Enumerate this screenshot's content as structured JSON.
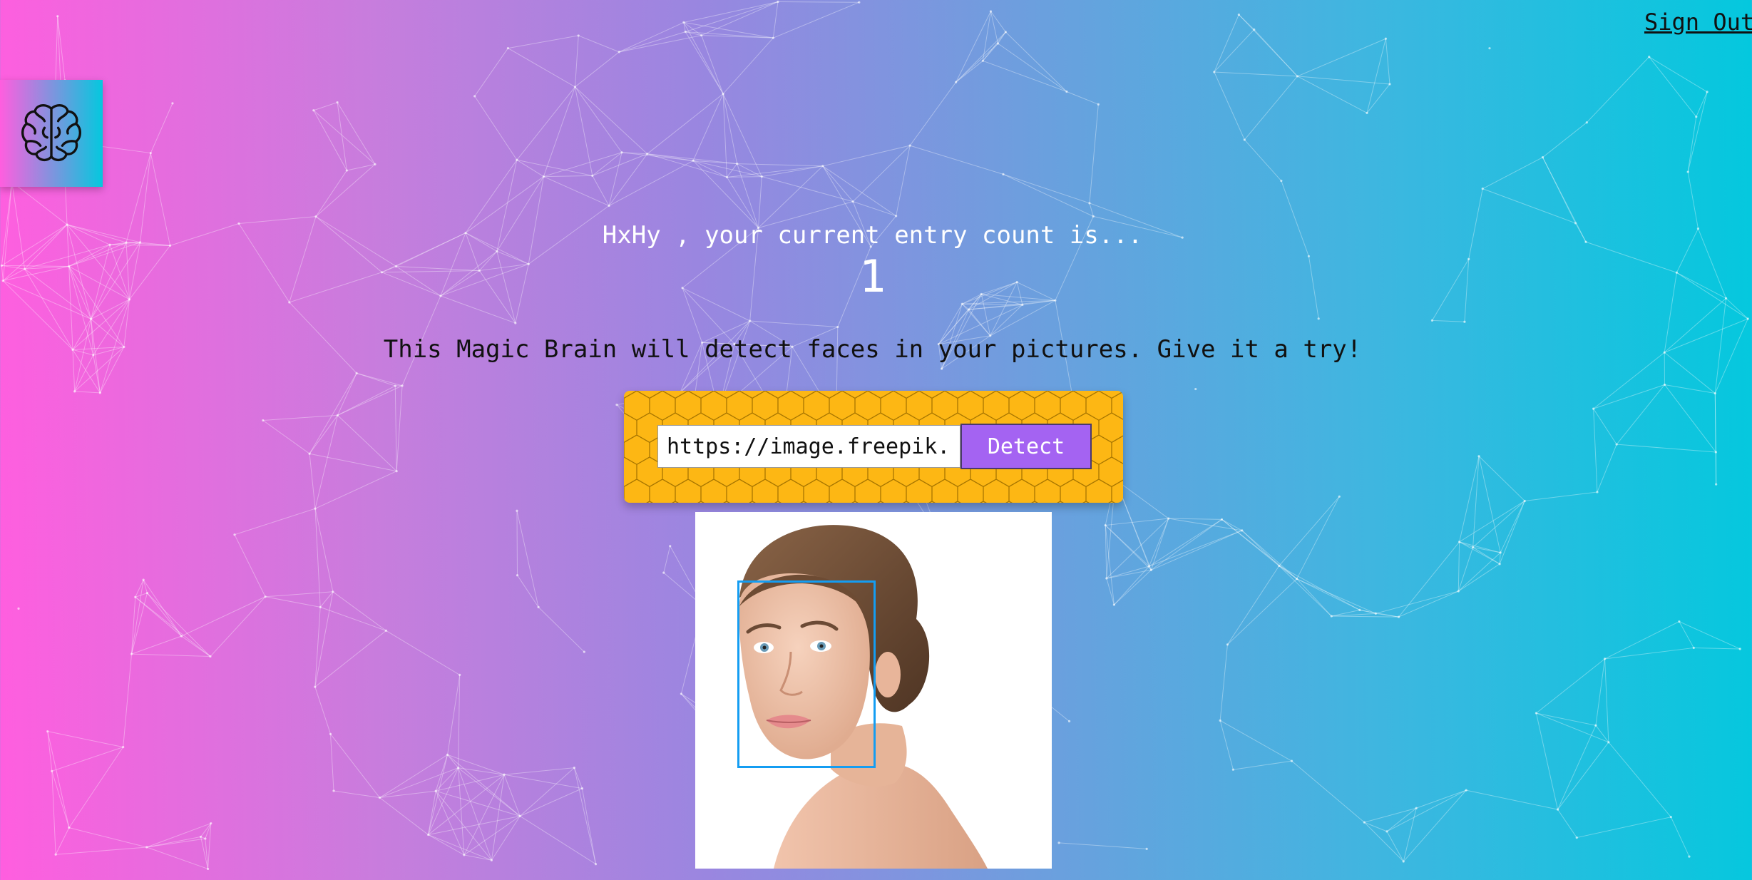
{
  "header": {
    "sign_out_label": "Sign Out"
  },
  "logo": {
    "icon": "brain-icon"
  },
  "rank": {
    "greeting": "HxHy , your current entry count is...",
    "entry_count": "1"
  },
  "intro": {
    "tagline": "This Magic Brain will detect faces in your pictures. Give it a try!"
  },
  "image_form": {
    "input_value": "https://image.freepik.com/free-photo/beautiful-young-woman-with-clean-fresh-skin.jpg",
    "detect_label": "Detect"
  },
  "result": {
    "face_count": 1
  },
  "colors": {
    "gradient_start": "#ff5edf",
    "gradient_end": "#04c8de",
    "panel": "#fdb714",
    "button": "#a463f2",
    "face_box": "#149df2"
  }
}
